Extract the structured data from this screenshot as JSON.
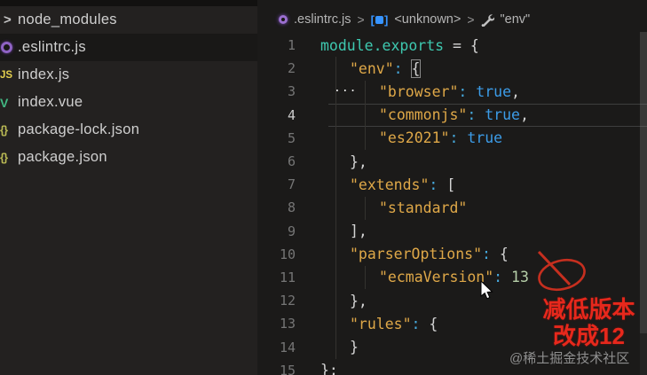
{
  "sidebar": {
    "items": [
      {
        "label": "node_modules",
        "icon": "chevron",
        "type": "folder",
        "selected": false
      },
      {
        "label": ".eslintrc.js",
        "icon": "eslint",
        "type": "file",
        "selected": true
      },
      {
        "label": "index.js",
        "icon": "js",
        "type": "file",
        "selected": false
      },
      {
        "label": "index.vue",
        "icon": "vue",
        "type": "file",
        "selected": false
      },
      {
        "label": "package-lock.json",
        "icon": "json",
        "type": "file",
        "selected": false
      },
      {
        "label": "package.json",
        "icon": "json",
        "type": "file",
        "selected": false
      }
    ]
  },
  "breadcrumb": {
    "file": ".eslintrc.js",
    "sep1": ">",
    "symbol": "<unknown>",
    "sep2": ">",
    "property": "\"env\""
  },
  "editor": {
    "current_line": 4,
    "lines": [
      {
        "num": 1,
        "indent": 0,
        "tokens": [
          {
            "t": "module.exports",
            "c": "prop"
          },
          {
            "t": " = {",
            "c": "plain"
          }
        ]
      },
      {
        "num": 2,
        "indent": 1,
        "tokens": [
          {
            "t": "\"env\"",
            "c": "key"
          },
          {
            "t": ":",
            "c": "colon"
          },
          {
            "t": " ",
            "c": "plain"
          },
          {
            "t": "{",
            "c": "bracebox"
          }
        ]
      },
      {
        "num": 3,
        "indent": 2,
        "tokens": [
          {
            "t": "\"browser\"",
            "c": "key"
          },
          {
            "t": ":",
            "c": "colon"
          },
          {
            "t": " ",
            "c": "plain"
          },
          {
            "t": "true",
            "c": "bool"
          },
          {
            "t": ",",
            "c": "plain"
          }
        ]
      },
      {
        "num": 4,
        "indent": 2,
        "tokens": [
          {
            "t": "\"commonjs\"",
            "c": "key"
          },
          {
            "t": ":",
            "c": "colon"
          },
          {
            "t": " ",
            "c": "plain"
          },
          {
            "t": "true",
            "c": "bool"
          },
          {
            "t": ",",
            "c": "plain"
          }
        ]
      },
      {
        "num": 5,
        "indent": 2,
        "tokens": [
          {
            "t": "\"es2021\"",
            "c": "key"
          },
          {
            "t": ":",
            "c": "colon"
          },
          {
            "t": " ",
            "c": "plain"
          },
          {
            "t": "true",
            "c": "bool"
          }
        ]
      },
      {
        "num": 6,
        "indent": 1,
        "tokens": [
          {
            "t": "},",
            "c": "plain"
          }
        ]
      },
      {
        "num": 7,
        "indent": 1,
        "tokens": [
          {
            "t": "\"extends\"",
            "c": "key"
          },
          {
            "t": ":",
            "c": "colon"
          },
          {
            "t": " [",
            "c": "plain"
          }
        ]
      },
      {
        "num": 8,
        "indent": 2,
        "tokens": [
          {
            "t": "\"standard\"",
            "c": "key"
          }
        ]
      },
      {
        "num": 9,
        "indent": 1,
        "tokens": [
          {
            "t": "],",
            "c": "plain"
          }
        ]
      },
      {
        "num": 10,
        "indent": 1,
        "tokens": [
          {
            "t": "\"parserOptions\"",
            "c": "key"
          },
          {
            "t": ":",
            "c": "colon"
          },
          {
            "t": " {",
            "c": "plain"
          }
        ]
      },
      {
        "num": 11,
        "indent": 2,
        "tokens": [
          {
            "t": "\"ecmaVersion\"",
            "c": "key"
          },
          {
            "t": ":",
            "c": "colon"
          },
          {
            "t": " ",
            "c": "plain"
          },
          {
            "t": "13",
            "c": "num"
          }
        ]
      },
      {
        "num": 12,
        "indent": 1,
        "tokens": [
          {
            "t": "},",
            "c": "plain"
          }
        ]
      },
      {
        "num": 13,
        "indent": 1,
        "tokens": [
          {
            "t": "\"rules\"",
            "c": "key"
          },
          {
            "t": ":",
            "c": "colon"
          },
          {
            "t": " {",
            "c": "plain"
          }
        ]
      },
      {
        "num": 14,
        "indent": 1,
        "tokens": [
          {
            "t": "}",
            "c": "plain"
          }
        ]
      },
      {
        "num": 15,
        "indent": 0,
        "tokens": [
          {
            "t": "};",
            "c": "plain"
          }
        ]
      }
    ]
  },
  "annotations": {
    "note_line1": "减低版本",
    "note_line2": "改成12",
    "watermark": "@稀土掘金技术社区"
  },
  "colors": {
    "editor_bg": "#1b1a19",
    "sidebar_bg": "#232120",
    "key_orange": "#dfa848",
    "prop_teal": "#3ec9b0",
    "bool_blue": "#3c9ce8",
    "number_green": "#b5cea8",
    "colon_cyan": "#46a9dd",
    "eslint_purple": "#8f63c4",
    "js_yellow": "#e3cf4e",
    "vue_green": "#42b883",
    "json_olive": "#b9b954",
    "module_blue": "#3794ff",
    "annotation_red": "#e7281c"
  }
}
